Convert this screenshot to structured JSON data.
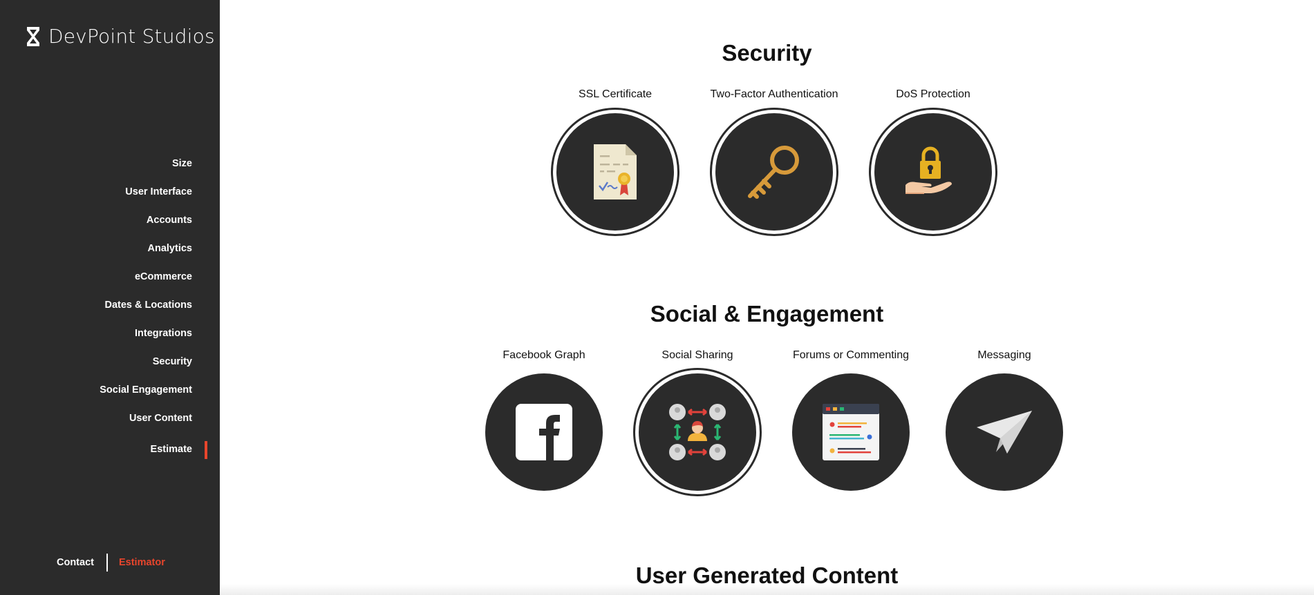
{
  "brand": {
    "name": "DevPoint Studios"
  },
  "sidebar": {
    "items": [
      {
        "label": "Size"
      },
      {
        "label": "User Interface"
      },
      {
        "label": "Accounts"
      },
      {
        "label": "Analytics"
      },
      {
        "label": "eCommerce"
      },
      {
        "label": "Dates & Locations"
      },
      {
        "label": "Integrations"
      },
      {
        "label": "Security"
      },
      {
        "label": "Social Engagement"
      },
      {
        "label": "User Content"
      },
      {
        "label": "Estimate"
      }
    ],
    "active_item": "Estimate",
    "accent_color": "#e8452c"
  },
  "footer": {
    "contact": "Contact",
    "estimator": "Estimator"
  },
  "sections": {
    "security": {
      "title": "Security",
      "features": [
        {
          "label": "SSL Certificate",
          "icon": "certificate-icon",
          "selected": true
        },
        {
          "label": "Two-Factor Authentication",
          "icon": "key-icon",
          "selected": true
        },
        {
          "label": "DoS Protection",
          "icon": "padlock-hand-icon",
          "selected": true
        }
      ]
    },
    "social": {
      "title": "Social & Engagement",
      "features": [
        {
          "label": "Facebook Graph",
          "icon": "facebook-icon",
          "selected": false
        },
        {
          "label": "Social Sharing",
          "icon": "social-network-icon",
          "selected": true
        },
        {
          "label": "Forums or Commenting",
          "icon": "forum-window-icon",
          "selected": false
        },
        {
          "label": "Messaging",
          "icon": "paper-plane-icon",
          "selected": false
        }
      ]
    },
    "user_content": {
      "title": "User Generated Content"
    }
  },
  "colors": {
    "circle": "#2b2b2b",
    "sidebar": "#2b2b2b",
    "accent": "#e8452c"
  }
}
